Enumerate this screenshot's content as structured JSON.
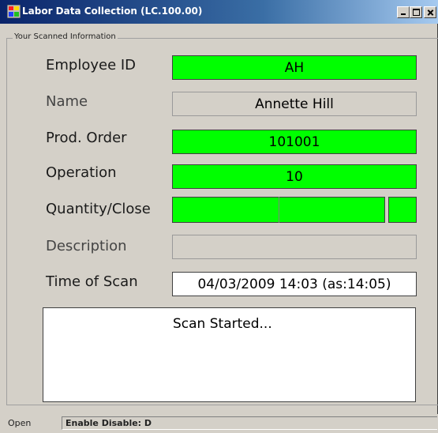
{
  "window": {
    "title": "Labor Data Collection (LC.100.00)",
    "icon": "app-window-icon"
  },
  "group": {
    "legend": "Your Scanned Information"
  },
  "fields": {
    "employee_id": {
      "label": "Employee ID",
      "value": "AH"
    },
    "name": {
      "label": "Name",
      "value": "Annette Hill"
    },
    "prod_order": {
      "label": "Prod. Order",
      "value": "101001"
    },
    "operation": {
      "label": "Operation",
      "value": "10"
    },
    "quantity_close": {
      "label": "Quantity/Close"
    },
    "description": {
      "label": "Description",
      "value": ""
    },
    "time_of_scan": {
      "label": "Time of Scan",
      "value": "04/03/2009 14:03 (as:14:05)"
    }
  },
  "log": {
    "lines": [
      "Scan Started..."
    ]
  },
  "status": {
    "left": "Open",
    "panel": "Enable Disable: D"
  },
  "colors": {
    "scanned_field": "#00ff00",
    "window_face": "#d4d0c8",
    "title_bar": "#0a246a"
  }
}
